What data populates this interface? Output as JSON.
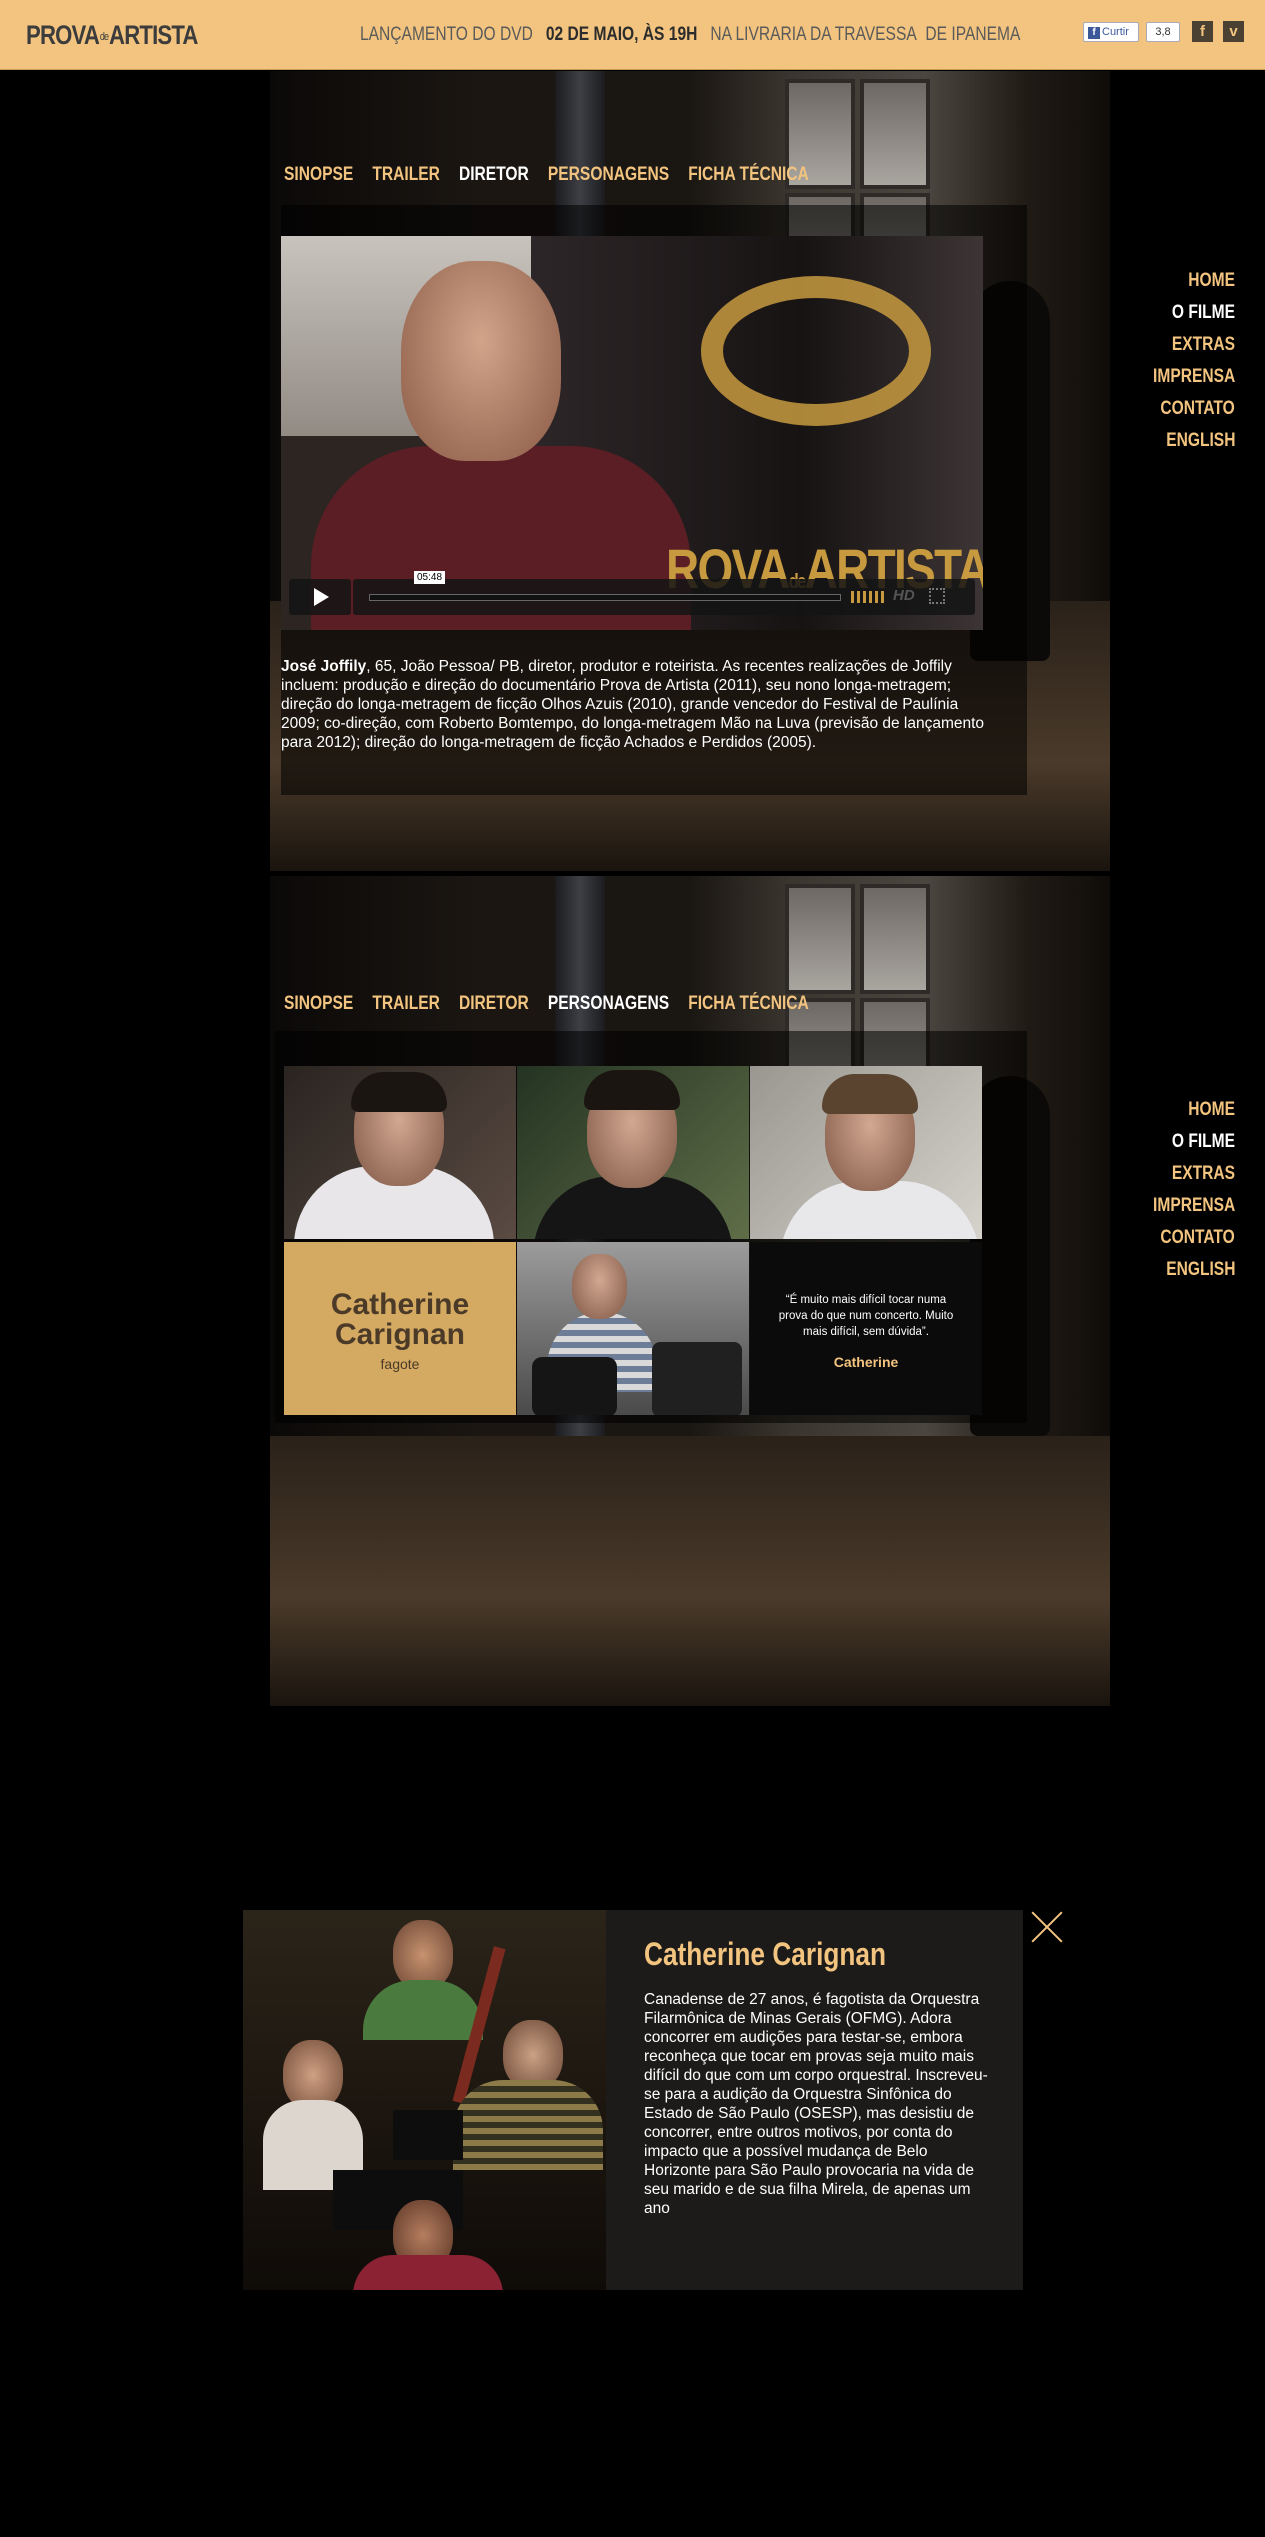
{
  "header": {
    "logo_prova": "PROVA",
    "logo_de": "de",
    "logo_artista": "ARTISTA",
    "announce_1": "LANÇAMENTO DO DVD",
    "announce_2": "02 DE MAIO, ÀS 19H",
    "announce_3": "NA LIVRARIA DA TRAVESSA",
    "announce_4": "DE IPANEMA",
    "like_label": "Curtir",
    "like_count": "3,8",
    "facebook_glyph": "f",
    "vimeo_glyph": "v"
  },
  "tabs": [
    "SINOPSE",
    "TRAILER",
    "DIRETOR",
    "PERSONAGENS",
    "FICHA TÉCNICA"
  ],
  "sidenav": [
    "HOME",
    "O FILME",
    "EXTRAS",
    "IMPRENSA",
    "CONTATO",
    "ENGLISH"
  ],
  "video": {
    "timecode": "05:48",
    "hd_label": "HD",
    "poster_title_pre": "ROVA",
    "poster_title_de": "de",
    "poster_title_post": "ARTISTA",
    "progress": 0.0
  },
  "bio": {
    "name": "José Joffily",
    "text": ", 65, João Pessoa/ PB, diretor, produtor e roteirista. As recentes realizações de Joffily incluem: produção e direção do documentário Prova de Artista (2011), seu nono longa-metragem; direção do longa-metragem de ficção Olhos Azuis (2010), grande vencedor do Festival de Paulínia 2009; co-direção, com Roberto Bomtempo, do longa-metragem Mão na Luva (previsão de lançamento para 2012); direção do longa-metragem de ficção Achados e Perdidos (2005)."
  },
  "character_card": {
    "name_line1": "Catherine",
    "name_line2": "Carignan",
    "instrument": "fagote"
  },
  "quote": {
    "text": "“É muito mais difícil tocar numa prova do que num concerto. Muito mais difícil, sem dúvida”.",
    "author": "Catherine"
  },
  "modal": {
    "title": "Catherine Carignan",
    "text": "Canadense de 27 anos, é fagotista da Orquestra Filarmônica de Minas Gerais (OFMG). Adora concorrer em audições para testar-se, embora reconheça que tocar em provas seja muito mais difícil do que com um corpo orquestral. Inscreveu-se para a audição da Orquestra Sinfônica do Estado de São Paulo (OSESP), mas desistiu de concorrer, entre outros motivos, por conta do impacto que a possível mudança de Belo Horizonte para São Paulo provocaria na vida de seu marido e de sua filha Mirela, de apenas um ano"
  },
  "colors": {
    "accent": "#f2c47f",
    "header_bg": "#f2c47f",
    "card_bg": "#d4a962"
  }
}
